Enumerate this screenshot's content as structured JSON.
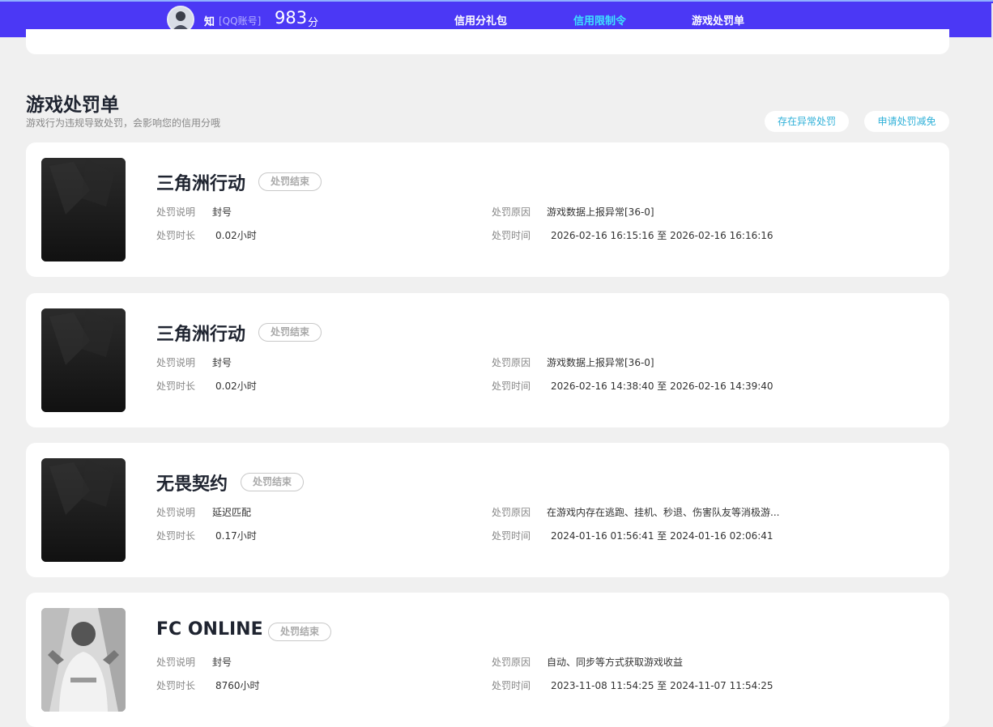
{
  "header": {
    "user_name": "知",
    "account_type": "[QQ账号]",
    "score": "983",
    "score_unit": "分",
    "nav": [
      {
        "label": "信用分礼包",
        "active": false
      },
      {
        "label": "信用限制令",
        "active": true
      },
      {
        "label": "游戏处罚单",
        "active": false
      }
    ],
    "colors": {
      "bar": "#4b38f5",
      "active": "#3ee0ff"
    }
  },
  "section": {
    "title": "游戏处罚单",
    "subtitle": "游戏行为违规导致处罚，会影响您的信用分哦",
    "buttons": [
      "存在异常处罚",
      "申请处罚减免"
    ]
  },
  "labels": {
    "desc": "处罚说明",
    "duration": "处罚时长",
    "reason": "处罚原因",
    "time": "处罚时间"
  },
  "records": [
    {
      "game": "三角洲行动",
      "status": "处罚结束",
      "desc": "封号",
      "duration": "0.02小时",
      "reason": "游戏数据上报异常[36-0]",
      "time": "2026-02-16 16:15:16 至 2026-02-16 16:16:16",
      "thumb": "dark-game-art"
    },
    {
      "game": "三角洲行动",
      "status": "处罚结束",
      "desc": "封号",
      "duration": "0.02小时",
      "reason": "游戏数据上报异常[36-0]",
      "time": "2026-02-16 14:38:40 至 2026-02-16 14:39:40",
      "thumb": "dark-game-art"
    },
    {
      "game": "无畏契约",
      "status": "处罚结束",
      "desc": "延迟匹配",
      "duration": "0.17小时",
      "reason": "在游戏内存在逃跑、挂机、秒退、伤害队友等消极游...",
      "time": "2024-01-16 01:56:41 至 2024-01-16 02:06:41",
      "thumb": "dark-game-art"
    },
    {
      "game": "FC ONLINE",
      "status": "处罚结束",
      "desc": "封号",
      "duration": "8760小时",
      "reason": "自动、同步等方式获取游戏收益",
      "time": "2023-11-08 11:54:25 至 2024-11-07 11:54:25",
      "thumb": "football-player-art"
    }
  ]
}
